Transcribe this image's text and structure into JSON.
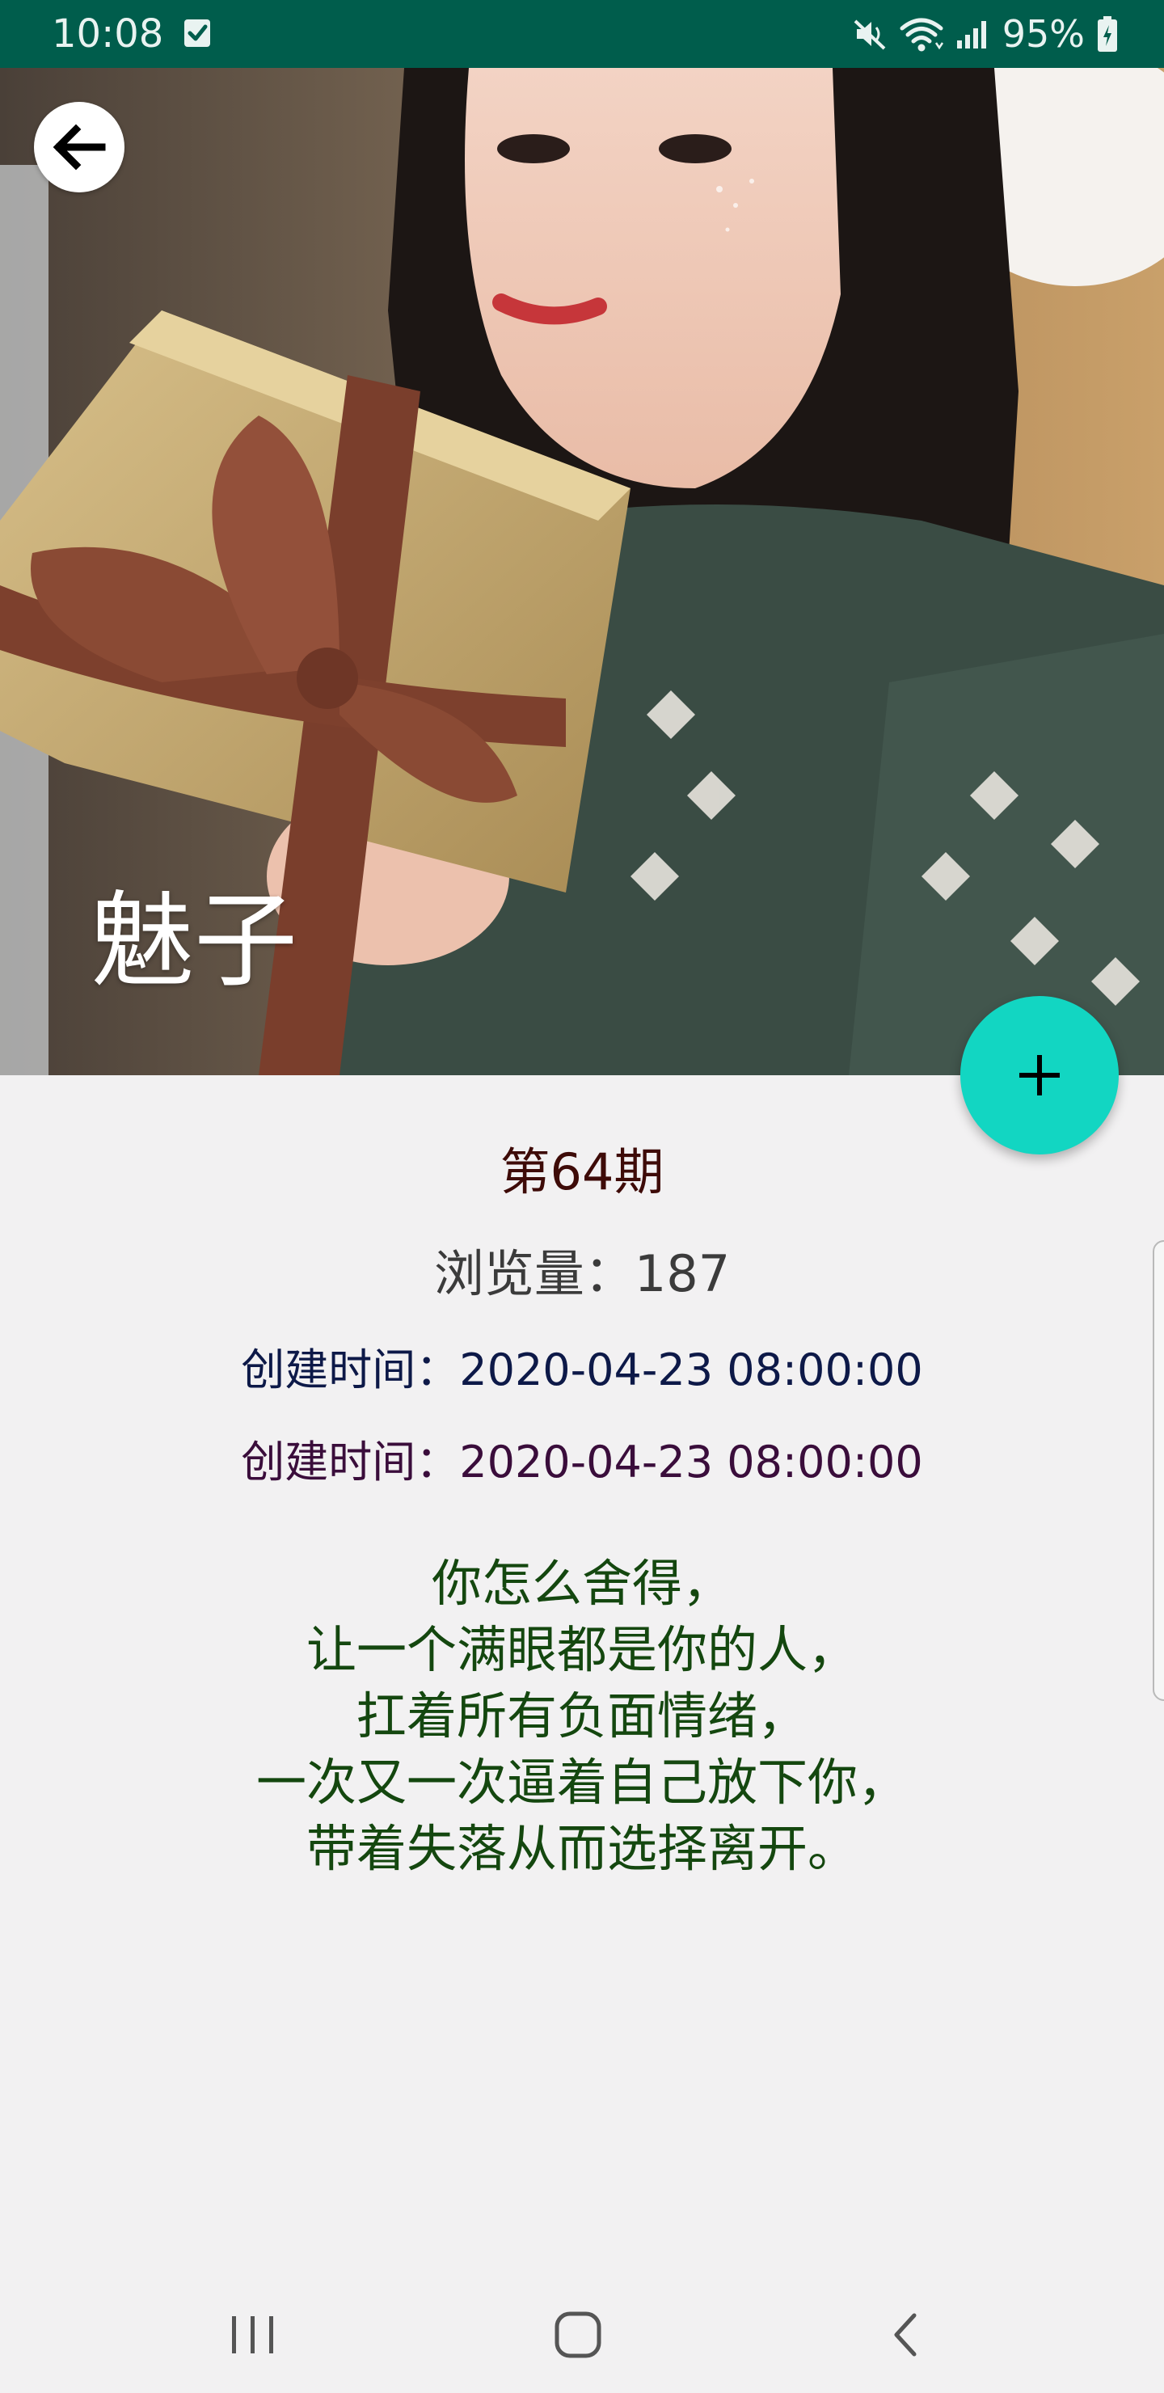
{
  "status_bar": {
    "time": "10:08",
    "battery_percent": "95%",
    "background_color": "#005d4c",
    "icons": [
      "notification-check-icon",
      "mute-icon",
      "wifi-icon",
      "signal-icon",
      "battery-charging-icon"
    ]
  },
  "hero": {
    "title": "魅子",
    "image_description_icon": "photo-icon"
  },
  "fab": {
    "icon": "plus-icon",
    "color": "#12d6c2"
  },
  "details": {
    "issue": "第64期",
    "views": "浏览量：187",
    "created_time_1": "创建时间：2020-04-23 08:00:00",
    "created_time_2": "创建时间：2020-04-23 08:00:00"
  },
  "poem": {
    "lines": [
      "你怎么舍得，",
      "让一个满眼都是你的人，",
      "扛着所有负面情绪，",
      "一次又一次逼着自己放下你，",
      "带着失落从而选择离开。"
    ],
    "color": "#14470f"
  },
  "nav_bar": {
    "icons": [
      "recent-apps-icon",
      "home-icon",
      "back-nav-icon"
    ]
  }
}
